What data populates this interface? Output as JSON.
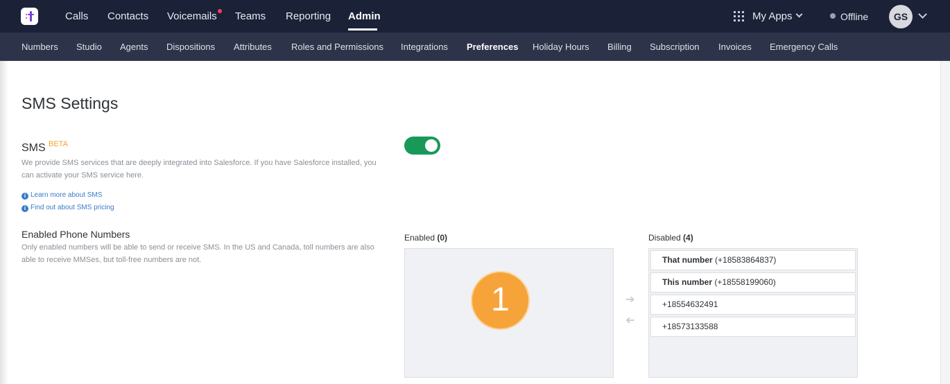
{
  "topnav": {
    "items": [
      {
        "label": "Calls"
      },
      {
        "label": "Contacts"
      },
      {
        "label": "Voicemails"
      },
      {
        "label": "Teams"
      },
      {
        "label": "Reporting"
      },
      {
        "label": "Admin"
      }
    ],
    "my_apps": "My Apps",
    "status": "Offline",
    "avatar_initials": "GS",
    "colors": {
      "bar": "#1b2137",
      "notification": "#ff3b5c",
      "logo": "#7b3fd6"
    }
  },
  "subnav": {
    "items": [
      {
        "label": "Numbers"
      },
      {
        "label": "Studio"
      },
      {
        "label": "Agents"
      },
      {
        "label": "Dispositions"
      },
      {
        "label": "Attributes"
      },
      {
        "label": "Roles and Permissions"
      },
      {
        "label": "Integrations"
      },
      {
        "label": "Preferences"
      },
      {
        "label": "Holiday Hours"
      },
      {
        "label": "Billing"
      },
      {
        "label": "Subscription"
      },
      {
        "label": "Invoices"
      },
      {
        "label": "Emergency Calls"
      }
    ],
    "active": "Preferences"
  },
  "page": {
    "title": "SMS Settings",
    "sms": {
      "label": "SMS",
      "badge": "BETA",
      "description_line1": "We provide SMS services that are deeply integrated into Salesforce. If you have Salesforce installed, you",
      "description_line2": "can activate your SMS service here.",
      "link1": "Learn more about SMS",
      "link2": "Find out about SMS pricing",
      "enabled": true,
      "toggle_color": "#17995a"
    },
    "phone_numbers": {
      "label": "Enabled Phone Numbers",
      "description_line1": "Only enabled numbers will be able to send or receive SMS. In the US and Canada, toll numbers are also",
      "description_line2": "able to receive MMSes, but toll-free numbers are not.",
      "enabled_title": "Enabled",
      "enabled_count": "(0)",
      "disabled_title": "Disabled",
      "disabled_count": "(4)",
      "step_badge": "1",
      "disabled_numbers": [
        {
          "name": "That number",
          "number": "(+18583864837)"
        },
        {
          "name": "This number",
          "number": "(+18558199060)"
        },
        {
          "name": "",
          "number": "+18554632491"
        },
        {
          "name": "",
          "number": "+18573133588"
        }
      ]
    }
  }
}
